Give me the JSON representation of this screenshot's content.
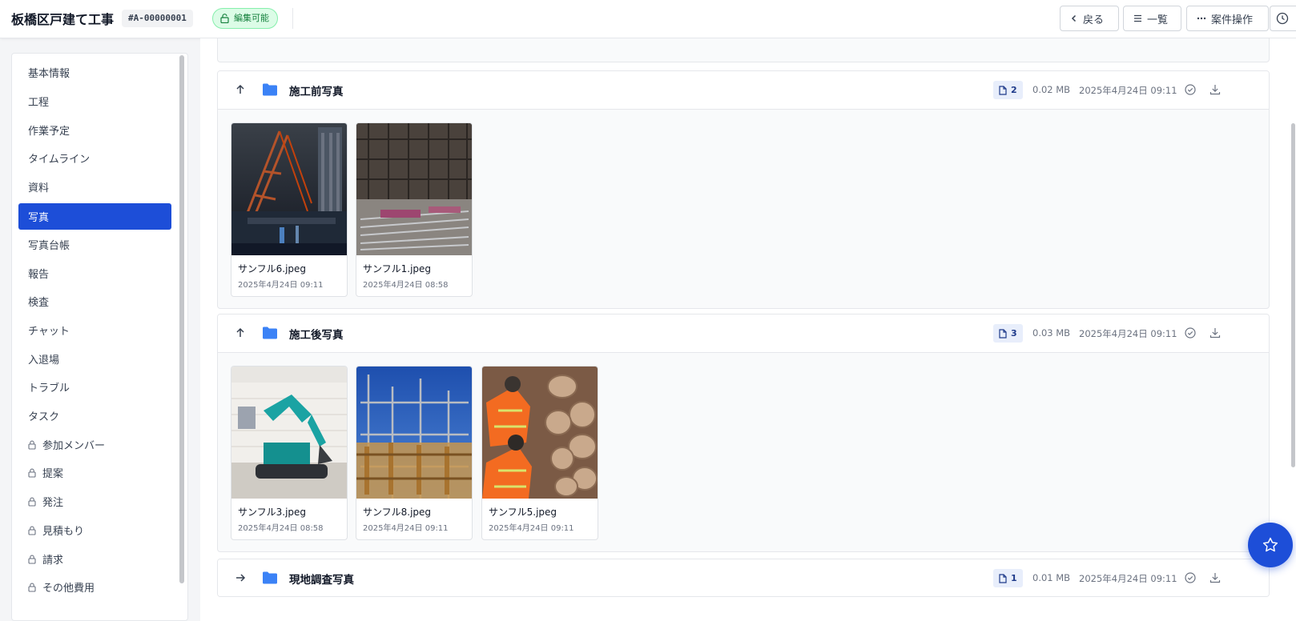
{
  "header": {
    "title": "板橋区戸建て工事",
    "case_id": "#A-00000001",
    "edit_status": "編集可能",
    "back_label": "戻る",
    "list_label": "一覧",
    "actions_label": "案件操作"
  },
  "sidebar": {
    "items": [
      {
        "label": "基本情報",
        "locked": false
      },
      {
        "label": "工程",
        "locked": false
      },
      {
        "label": "作業予定",
        "locked": false
      },
      {
        "label": "タイムライン",
        "locked": false
      },
      {
        "label": "資料",
        "locked": false
      },
      {
        "label": "写真",
        "locked": false,
        "active": true
      },
      {
        "label": "写真台帳",
        "locked": false
      },
      {
        "label": "報告",
        "locked": false
      },
      {
        "label": "検査",
        "locked": false
      },
      {
        "label": "チャット",
        "locked": false
      },
      {
        "label": "入退場",
        "locked": false
      },
      {
        "label": "トラブル",
        "locked": false
      },
      {
        "label": "タスク",
        "locked": false
      },
      {
        "label": "参加メンバー",
        "locked": true
      },
      {
        "label": "提案",
        "locked": true
      },
      {
        "label": "発注",
        "locked": true
      },
      {
        "label": "見積もり",
        "locked": true
      },
      {
        "label": "請求",
        "locked": true
      },
      {
        "label": "その他費用",
        "locked": true
      }
    ]
  },
  "folders": [
    {
      "name": "施工前写真",
      "count": "2",
      "size": "0.02 MB",
      "date": "2025年4月24日 09:11",
      "expanded": true,
      "photos": [
        {
          "name": "サンフル6.jpeg",
          "date": "2025年4月24日 09:11"
        },
        {
          "name": "サンフル1.jpeg",
          "date": "2025年4月24日 08:58"
        }
      ]
    },
    {
      "name": "施工後写真",
      "count": "3",
      "size": "0.03 MB",
      "date": "2025年4月24日 09:11",
      "expanded": true,
      "photos": [
        {
          "name": "サンフル3.jpeg",
          "date": "2025年4月24日 08:58"
        },
        {
          "name": "サンフル8.jpeg",
          "date": "2025年4月24日 09:11"
        },
        {
          "name": "サンフル5.jpeg",
          "date": "2025年4月24日 09:11"
        }
      ]
    },
    {
      "name": "現地調査写真",
      "count": "1",
      "size": "0.01 MB",
      "date": "2025年4月24日 09:11",
      "expanded": false,
      "photos": []
    }
  ],
  "colors": {
    "accent": "#1d4ed8",
    "folder_icon": "#3b82f6",
    "edit_badge_bg": "#dcfce7",
    "edit_badge_text": "#15803d"
  },
  "icons": {
    "lock": "lock-icon",
    "folder": "folder-icon",
    "star": "star-icon",
    "history": "clock-icon"
  }
}
